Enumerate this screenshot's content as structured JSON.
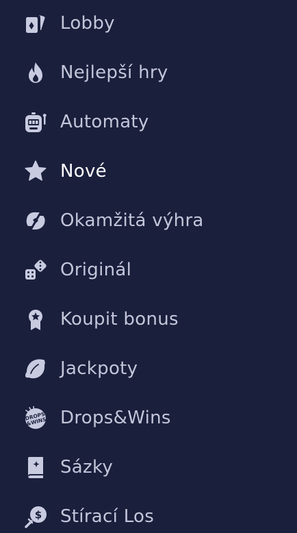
{
  "sidebar": {
    "items": [
      {
        "label": "Lobby",
        "icon": "cards-icon"
      },
      {
        "label": "Nejlepší hry",
        "icon": "flame-icon"
      },
      {
        "label": "Automaty",
        "icon": "slot-machine-icon"
      },
      {
        "label": "Nové",
        "icon": "star-icon"
      },
      {
        "label": "Okamžitá výhra",
        "icon": "instant-win-icon"
      },
      {
        "label": "Originál",
        "icon": "dice-icon"
      },
      {
        "label": "Koupit bonus",
        "icon": "badge-icon"
      },
      {
        "label": "Jackpoty",
        "icon": "lemon-icon"
      },
      {
        "label": "Drops&Wins",
        "icon": "drops-wins-icon"
      },
      {
        "label": "Sázky",
        "icon": "book-icon"
      },
      {
        "label": "Stírací Los",
        "icon": "scratch-coin-icon"
      }
    ],
    "icon_badge_text": {
      "drops": "DROPS",
      "wins": "&WINS",
      "dollar": "$"
    }
  },
  "colors": {
    "background": "#1a1f3c",
    "icon": "#c8cbe0",
    "label": "#c3c6d9",
    "active_label": "#ffffff"
  }
}
